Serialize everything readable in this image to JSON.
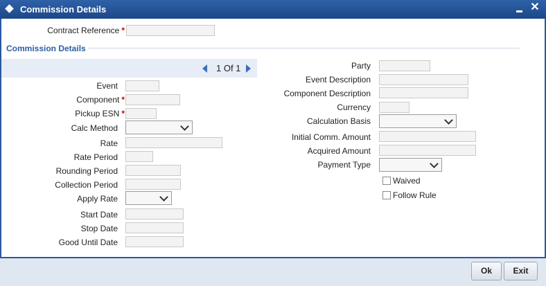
{
  "window": {
    "title": "Commission Details",
    "minimize_icon": "minimize-icon",
    "close_icon": "close-icon",
    "close_glyph": "✕"
  },
  "header": {
    "contract_reference_label": "Contract Reference",
    "contract_reference_value": ""
  },
  "section": {
    "title": "Commission Details"
  },
  "navigation": {
    "text": "1 Of 1"
  },
  "required_mark": "*",
  "left_fields": {
    "event": "Event",
    "component": "Component",
    "pickup_esn": "Pickup ESN",
    "calc_method": "Calc Method",
    "rate": "Rate",
    "rate_period": "Rate Period",
    "rounding_period": "Rounding Period",
    "collection_period": "Collection Period",
    "apply_rate": "Apply Rate",
    "start_date": "Start Date",
    "stop_date": "Stop Date",
    "good_until_date": "Good Until Date"
  },
  "right_fields": {
    "party": "Party",
    "event_description": "Event Description",
    "component_description": "Component Description",
    "currency": "Currency",
    "calculation_basis": "Calculation Basis",
    "initial_comm_amount": "Initial Comm. Amount",
    "acquired_amount": "Acquired Amount",
    "payment_type": "Payment Type",
    "waived": "Waived",
    "follow_rule": "Follow Rule"
  },
  "buttons": {
    "ok": "Ok",
    "exit": "Exit"
  }
}
